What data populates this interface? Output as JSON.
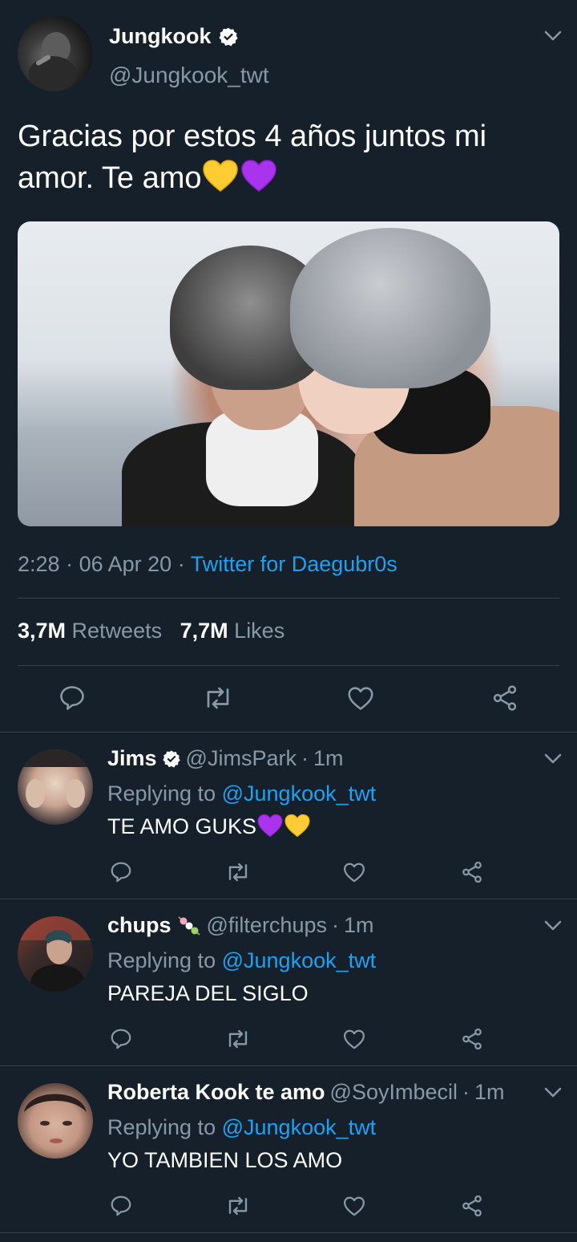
{
  "main_tweet": {
    "name": "Jungkook",
    "handle": "@Jungkook_twt",
    "text": "Gracias por estos 4 años juntos mi amor. Te amo",
    "emojis": [
      "yellow-heart",
      "purple-heart"
    ],
    "time": "2:28",
    "date": "06 Apr 20",
    "source": "Twitter for Daegubr0s",
    "retweets_count": "3,7M",
    "retweets_label": "Retweets",
    "likes_count": "7,7M",
    "likes_label": "Likes"
  },
  "replies": [
    {
      "name": "Jims",
      "verified": true,
      "handle": "@JimsPark",
      "time": "1m",
      "replying_label": "Replying to",
      "replying_to": "@Jungkook_twt",
      "text": "TE AMO GUKS",
      "emojis": [
        "purple-heart",
        "yellow-heart"
      ]
    },
    {
      "name": "chups",
      "name_emoji": "dango",
      "handle": "@filterchups",
      "time": "1m",
      "replying_label": "Replying to",
      "replying_to": "@Jungkook_twt",
      "text": "PAREJA DEL SIGLO"
    },
    {
      "name": "Roberta Kook te amo",
      "handle": "@SoyImbecil",
      "time": "1m",
      "replying_label": "Replying to",
      "replying_to": "@Jungkook_twt",
      "text": "YO TAMBIEN LOS AMO"
    }
  ],
  "colors": {
    "background": "#15202b",
    "accent": "#1da1f2",
    "muted": "#8899a6",
    "divider": "#38444d"
  },
  "icons": [
    "chevron-down-icon",
    "verified-badge-icon",
    "reply-icon",
    "retweet-icon",
    "like-icon",
    "share-icon"
  ]
}
